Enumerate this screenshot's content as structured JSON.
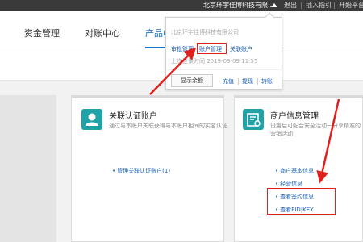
{
  "topbar": {
    "company": "北京环宇佳博科技有限...",
    "links": [
      "退出",
      "插入指引",
      "开始平台"
    ]
  },
  "nav": {
    "items": [
      "资金管理",
      "对账中心",
      "产品中"
    ]
  },
  "popup": {
    "company": "北京环宇佳博科技有限公司",
    "links": [
      "审批管理",
      "账户管理",
      "关联账户"
    ],
    "last_login": "上次登录时间 2019-09-09 11:55",
    "balance_button": "显示余额",
    "actions": [
      "充值",
      "提现",
      "转账"
    ]
  },
  "cards": {
    "related": {
      "title": "关联认证账户",
      "desc": "通过与本账户关联获得与本账户相同的实名认证",
      "links": [
        "管理关联认证账户(1)"
      ]
    },
    "merchant": {
      "title": "商户信息管理",
      "desc": "设置后可配合安全活动一分享精准的营销活动",
      "links": [
        "商户基本信息",
        "经营信息",
        "查看签约信息",
        "查看PID|KEY"
      ]
    }
  },
  "colors": {
    "accent": "#1a73c9",
    "topbar": "#3a3a3a",
    "icon_teal": "#1fa3a8",
    "annotation_red": "#e0201c"
  }
}
